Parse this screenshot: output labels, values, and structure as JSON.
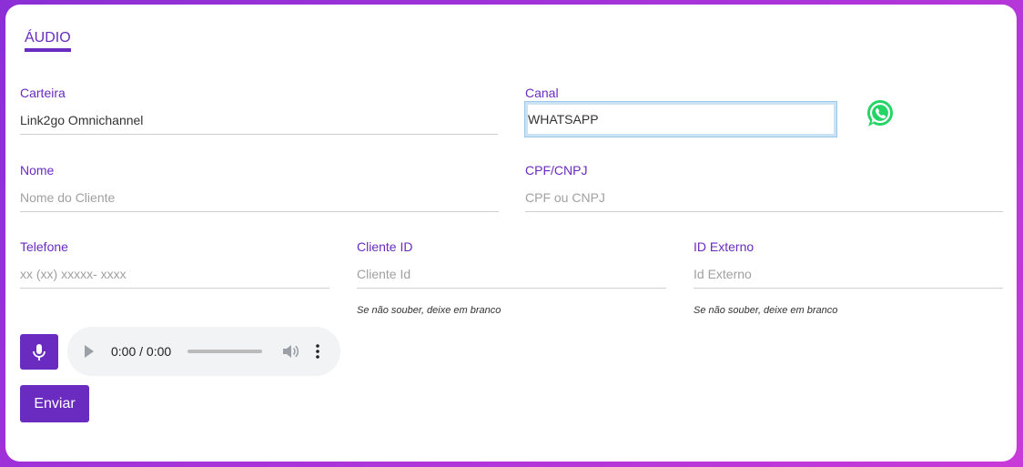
{
  "tabs": {
    "audio_label": "ÁUDIO"
  },
  "form": {
    "carteira": {
      "label": "Carteira",
      "value": "Link2go Omnichannel"
    },
    "canal": {
      "label": "Canal",
      "value": "WHATSAPP"
    },
    "nome": {
      "label": "Nome",
      "placeholder": "Nome do Cliente"
    },
    "cpf": {
      "label": "CPF/CNPJ",
      "placeholder": "CPF ou CNPJ"
    },
    "telefone": {
      "label": "Telefone",
      "placeholder": "xx (xx) xxxxx- xxxx"
    },
    "cliente_id": {
      "label": "Cliente ID",
      "placeholder": "Cliente Id",
      "hint": "Se não souber, deixe em branco"
    },
    "id_externo": {
      "label": "ID Externo",
      "placeholder": "Id Externo",
      "hint": "Se não souber, deixe em branco"
    }
  },
  "icons": {
    "channel": "whatsapp-icon",
    "record": "microphone-icon"
  },
  "audio": {
    "time": "0:00 / 0:00"
  },
  "actions": {
    "send_label": "Enviar"
  },
  "colors": {
    "accent": "#6a2bc0",
    "whatsapp": "#25d366"
  }
}
